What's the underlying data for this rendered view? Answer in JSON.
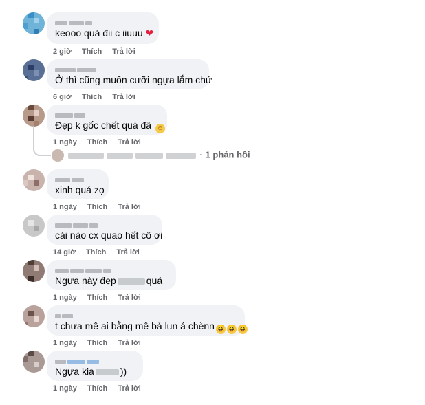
{
  "comments": [
    {
      "text": "keooo quá đii c iiuuu",
      "time": "2 giờ",
      "like": "Thích",
      "reply": "Trả lời"
    },
    {
      "text": "Ở thì cũng muốn cưỡi ngựa lắm chứ",
      "time": "6 giờ",
      "like": "Thích",
      "reply": "Trả lời"
    },
    {
      "text": "Đẹp k gốc chết quá đã",
      "time": "1 ngày",
      "like": "Thích",
      "reply": "Trả lời"
    },
    {
      "text": "xinh quá zọ",
      "time": "1 ngày",
      "like": "Thích",
      "reply": "Trả lời"
    },
    {
      "text": "cái nào cx quao hết cô ơi",
      "time": "14 giờ",
      "like": "Thích",
      "reply": "Trả lời"
    },
    {
      "text_before": "Ngựa này đẹp",
      "text_after": "quá",
      "time": "1 ngày",
      "like": "Thích",
      "reply": "Trả lời"
    },
    {
      "text": "t chưa mê ai bằng mê bả lun á chènn",
      "time": "1 ngày",
      "like": "Thích",
      "reply": "Trả lời"
    },
    {
      "text_before": "Ngựa kia",
      "text_after": "))",
      "time": "1 ngày",
      "like": "Thích",
      "reply": "Trả lời"
    }
  ],
  "reply_summary": "· 1 phản hồi",
  "icons": {
    "heart": "heart-icon",
    "emoji": "laughing-emoji-icon",
    "smile": "smiling-emoji-icon"
  },
  "colors": {
    "bubble": "#f0f2f5",
    "meta": "#65676b",
    "heart": "#e41e3f"
  }
}
